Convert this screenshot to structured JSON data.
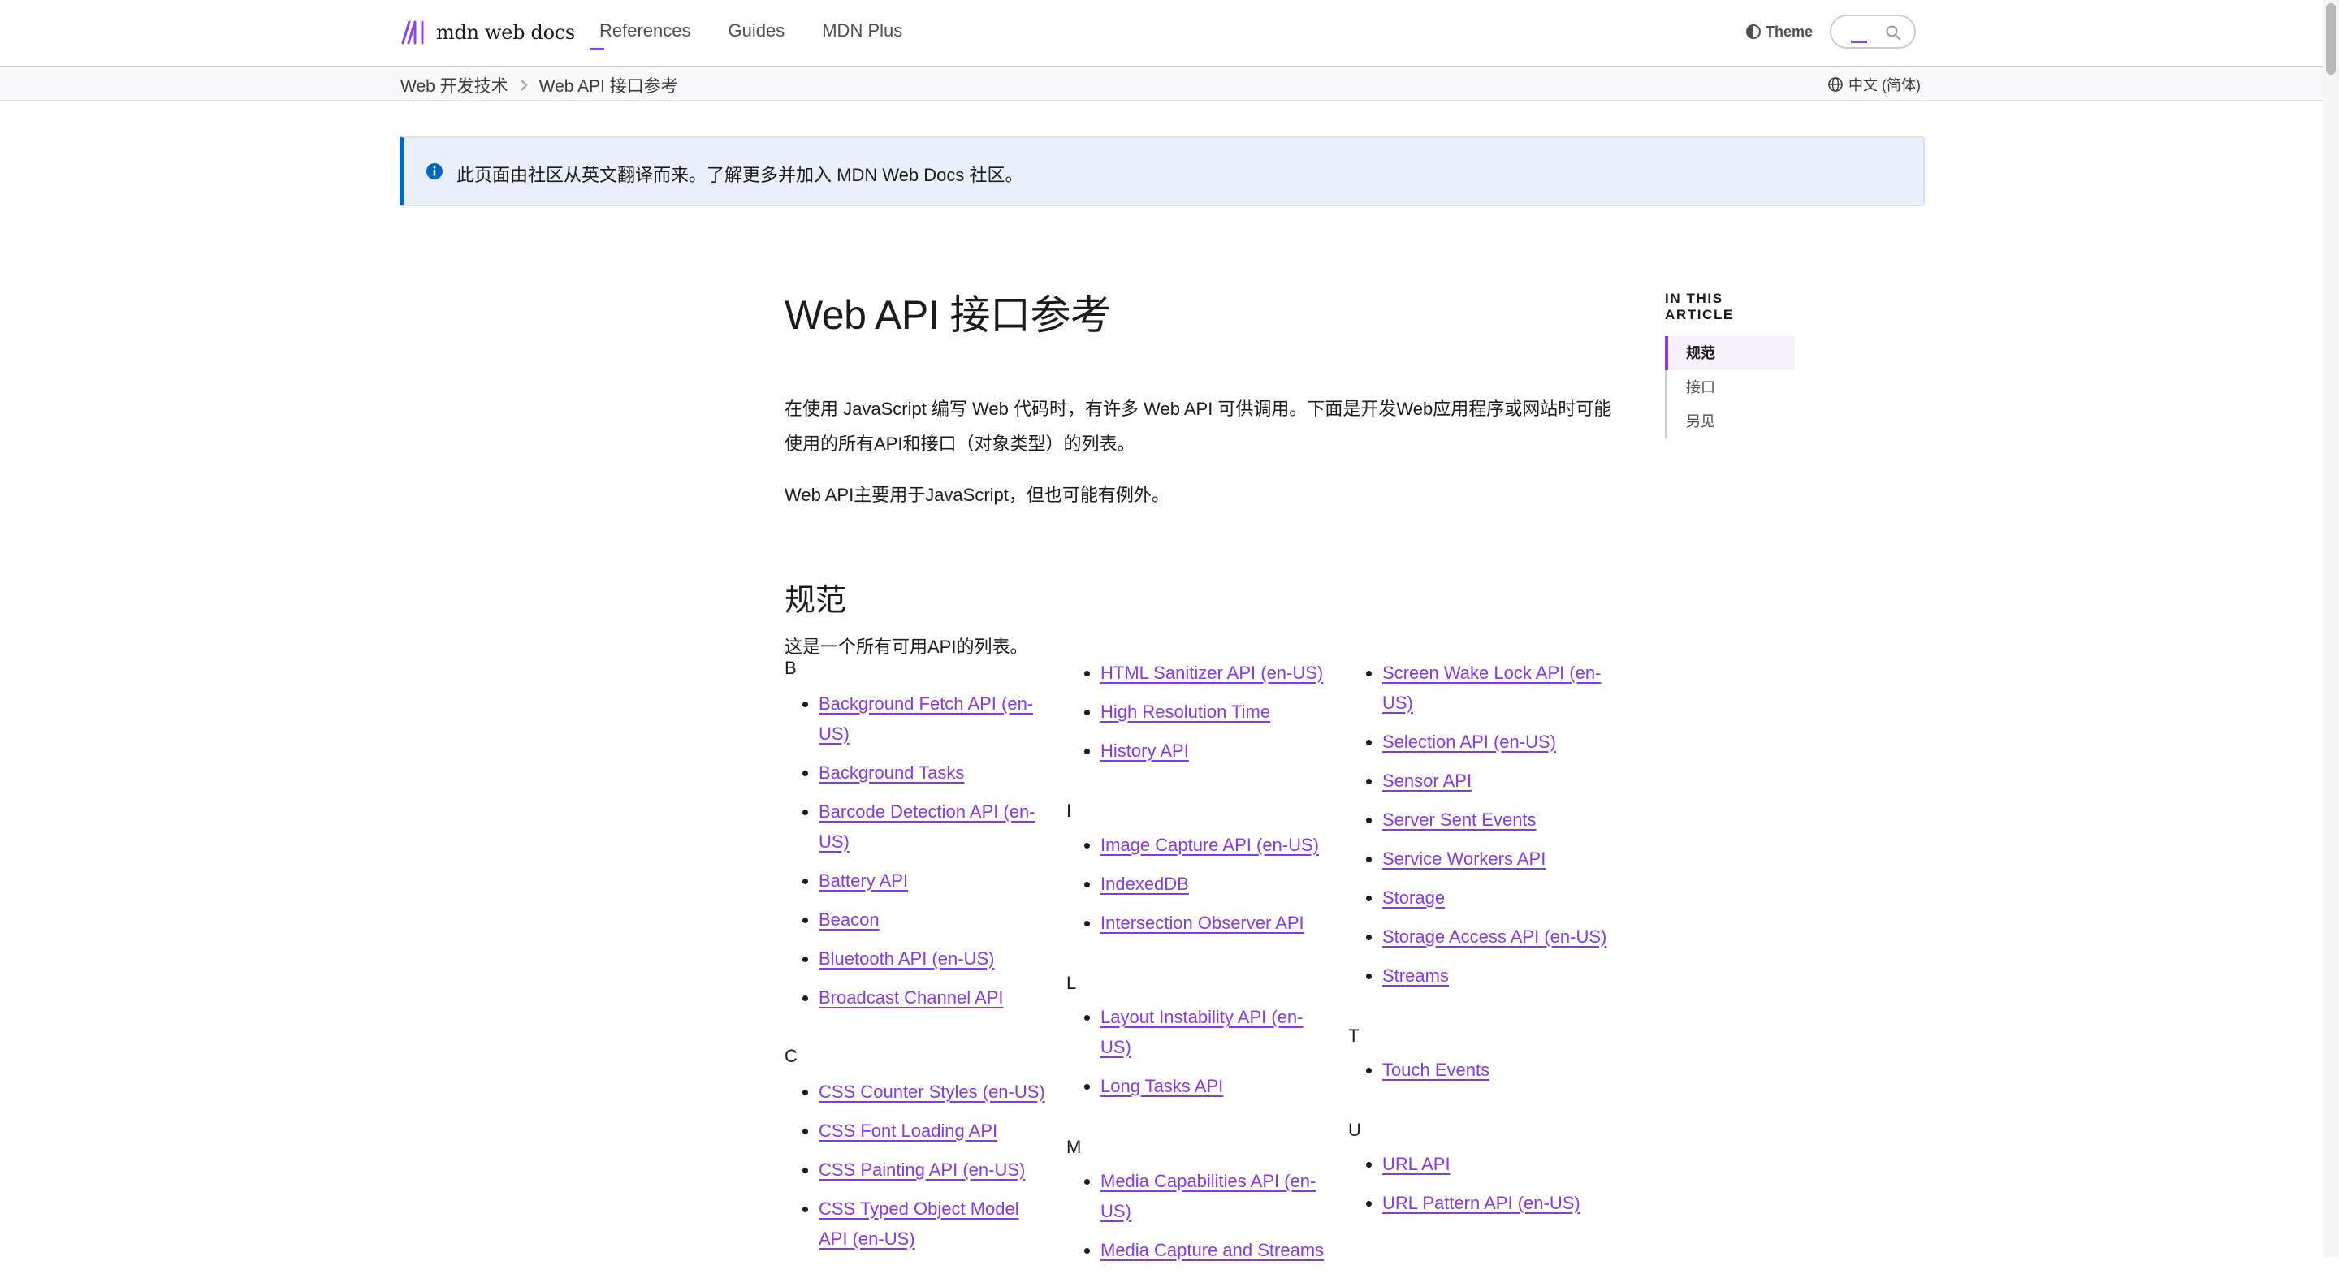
{
  "header": {
    "logo_text": "mdn web docs",
    "nav": [
      "References",
      "Guides",
      "MDN Plus"
    ],
    "theme_label": "Theme"
  },
  "breadcrumb": [
    "Web 开发技术",
    "Web API 接口参考"
  ],
  "language": "中文 (简体)",
  "notice": "此页面由社区从英文翻译而来。了解更多并加入 MDN Web Docs 社区。",
  "article": {
    "title": "Web API 接口参考",
    "intro_1": "在使用 JavaScript 编写 Web 代码时，有许多 Web API 可供调用。下面是开发Web应用程序或网站时可能使用的所有API和接口（对象类型）的列表。",
    "intro_2": "Web API主要用于JavaScript，但也可能有例外。",
    "spec_heading": "规范",
    "spec_intro": "这是一个所有可用API的列表。"
  },
  "groups": [
    {
      "letter": "B",
      "items": [
        "Background Fetch API (en-US)",
        "Background Tasks",
        "Barcode Detection API (en-US)",
        "Battery API",
        "Beacon",
        "Bluetooth API (en-US)",
        "Broadcast Channel API"
      ]
    },
    {
      "letter": "C",
      "items": [
        "CSS Counter Styles (en-US)",
        "CSS Font Loading API",
        "CSS Painting API (en-US)",
        "CSS Typed Object Model API (en-US)"
      ]
    },
    {
      "letter": "",
      "items": [
        "HTML Sanitizer API (en-US)",
        "High Resolution Time",
        "History API"
      ]
    },
    {
      "letter": "I",
      "items": [
        "Image Capture API (en-US)",
        "IndexedDB",
        "Intersection Observer API"
      ]
    },
    {
      "letter": "L",
      "items": [
        "Layout Instability API (en-US)",
        "Long Tasks API"
      ]
    },
    {
      "letter": "M",
      "items": [
        "Media Capabilities API (en-US)",
        "Media Capture and Streams"
      ]
    },
    {
      "letter": "",
      "items": [
        "Screen Wake Lock API (en-US)",
        "Selection API (en-US)",
        "Sensor API",
        "Server Sent Events",
        "Service Workers API",
        "Storage",
        "Storage Access API (en-US)",
        "Streams"
      ]
    },
    {
      "letter": "T",
      "items": [
        "Touch Events"
      ]
    },
    {
      "letter": "U",
      "items": [
        "URL API",
        "URL Pattern API (en-US)"
      ]
    }
  ],
  "toc": {
    "title": "IN THIS ARTICLE",
    "items": [
      "规范",
      "接口",
      "另见"
    ]
  },
  "colors": {
    "link": "#8a39e0",
    "accent": "#8e44e6",
    "notice_border": "#0069c2"
  }
}
